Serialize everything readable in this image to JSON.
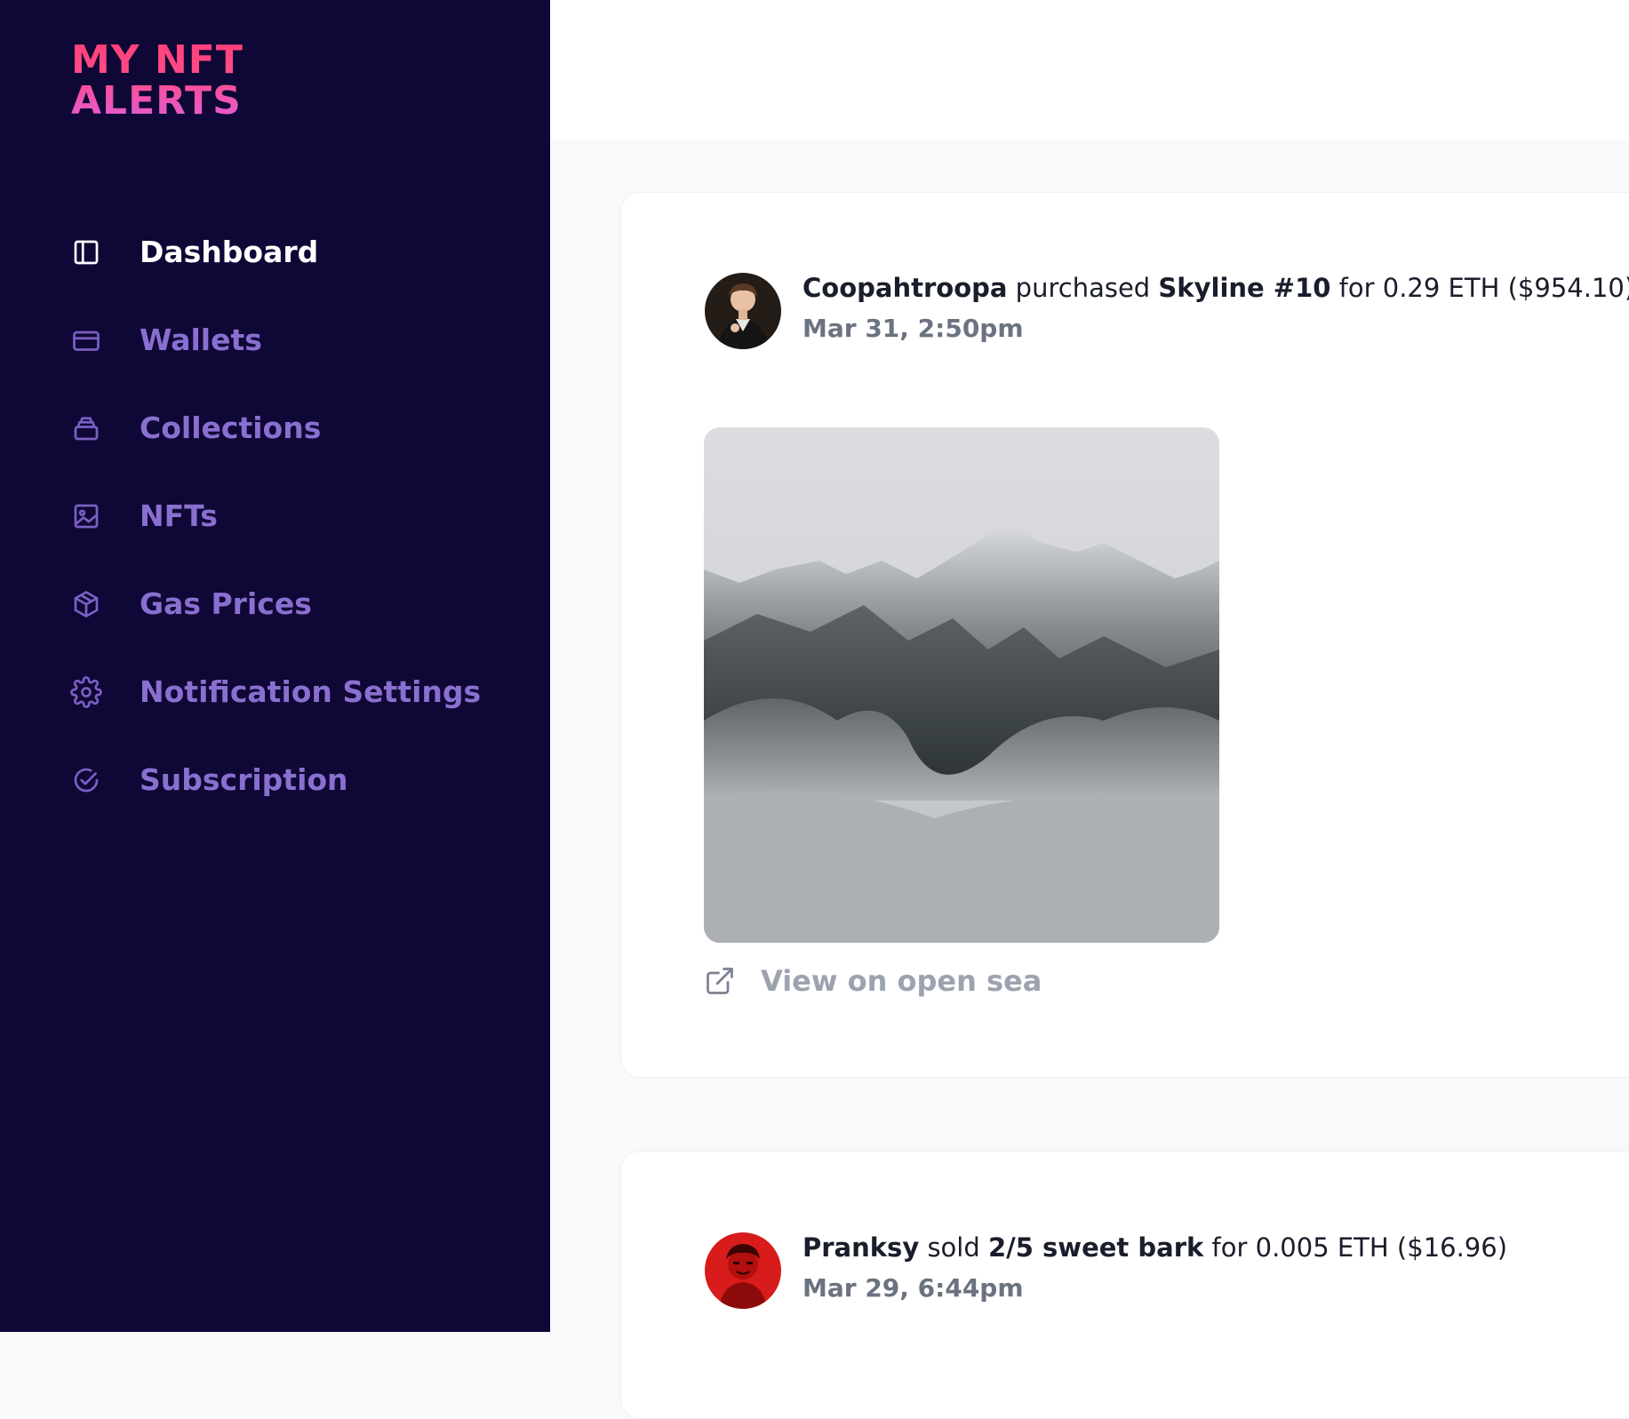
{
  "brand": {
    "line1": "MY NFT",
    "line2": "ALERTS"
  },
  "sidebar": {
    "items": [
      {
        "label": "Dashboard",
        "icon": "dashboard-icon",
        "active": true
      },
      {
        "label": "Wallets",
        "icon": "wallet-icon"
      },
      {
        "label": "Collections",
        "icon": "collections-icon"
      },
      {
        "label": "NFTs",
        "icon": "image-icon"
      },
      {
        "label": "Gas Prices",
        "icon": "cube-icon"
      },
      {
        "label": "Notification Settings",
        "icon": "gear-icon"
      },
      {
        "label": "Subscription",
        "icon": "check-circle-icon"
      }
    ]
  },
  "feed": {
    "items": [
      {
        "user": "Coopahtroopa",
        "action": "purchased",
        "item": "Skyline #10",
        "price": "for 0.29 ETH ($954.10)",
        "time": "Mar 31, 2:50pm",
        "link_label": "View on open sea"
      },
      {
        "user": "Pranksy",
        "action": "sold",
        "item": "2/5 sweet bark",
        "price": "for 0.005 ETH ($16.96)",
        "time": "Mar 29, 6:44pm"
      }
    ]
  },
  "colors": {
    "sidebar_bg": "#0f0735",
    "nav_text": "#8a6fd0",
    "nav_active": "#ffffff",
    "brand_gradient_start": "#ff3f77",
    "brand_gradient_end": "#e05cd6"
  }
}
